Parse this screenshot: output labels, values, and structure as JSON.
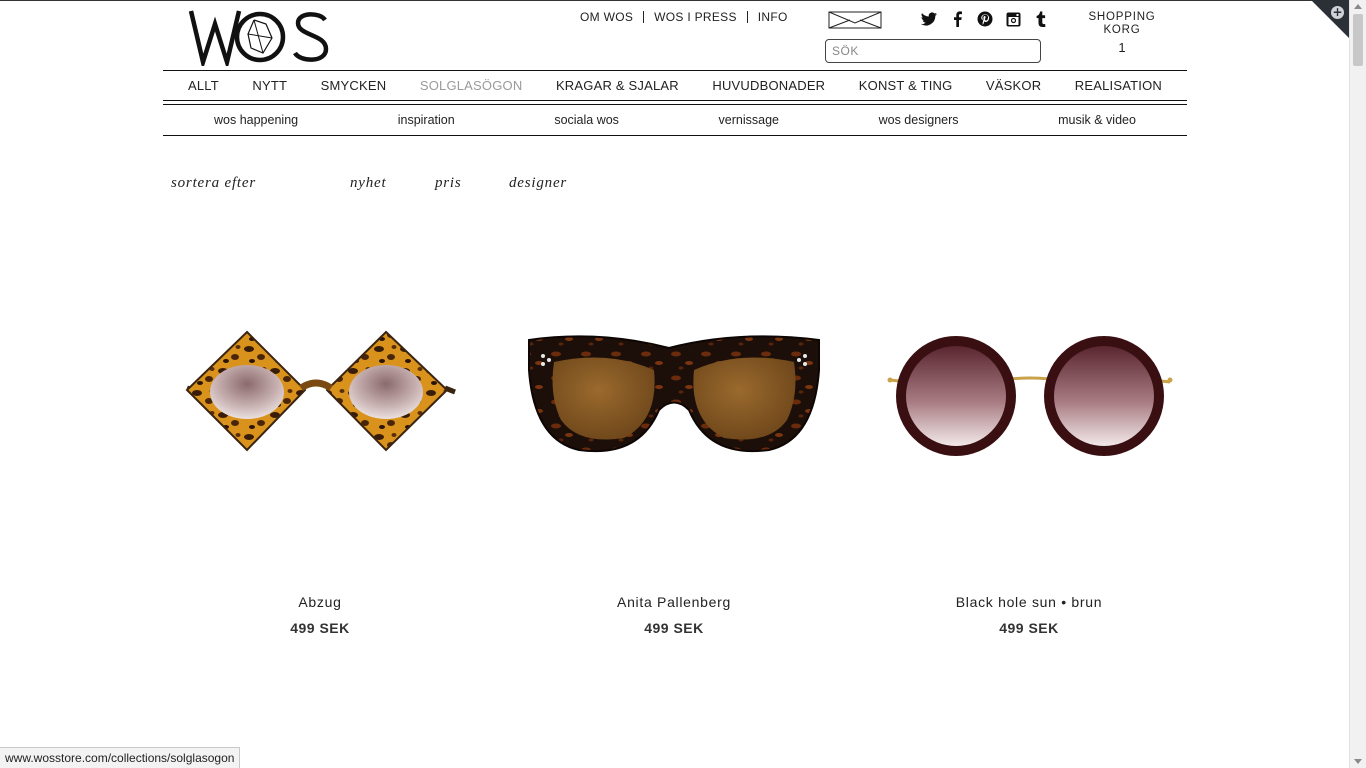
{
  "brand": {
    "logo_text": "WOS"
  },
  "top_links": [
    "OM WOS",
    "WOS I PRESS",
    "INFO"
  ],
  "search": {
    "placeholder": "SÖK",
    "value": ""
  },
  "cart": {
    "label_line1": "SHOPPING",
    "label_line2": "KORG",
    "count": "1"
  },
  "social_icons": [
    "twitter-icon",
    "facebook-icon",
    "pinterest-icon",
    "instagram-icon",
    "tumblr-icon"
  ],
  "main_nav": [
    {
      "label": "ALLT"
    },
    {
      "label": "NYTT"
    },
    {
      "label": "SMYCKEN"
    },
    {
      "label": "SOLGLASÖGON",
      "active": true
    },
    {
      "label": "KRAGAR & SJALAR"
    },
    {
      "label": "HUVUDBONADER"
    },
    {
      "label": "KONST & TING"
    },
    {
      "label": "VÄSKOR"
    },
    {
      "label": "REALISATION"
    }
  ],
  "sub_nav": [
    "wos happening",
    "inspiration",
    "sociala wos",
    "vernissage",
    "wos designers",
    "musik & video"
  ],
  "sort": {
    "label": "sortera efter",
    "options": [
      "nyhet",
      "pris",
      "designer"
    ]
  },
  "products": [
    {
      "name": "Abzug",
      "price": "499 SEK"
    },
    {
      "name": "Anita Pallenberg",
      "price": "499 SEK"
    },
    {
      "name": "Black hole sun • brun",
      "price": "499 SEK"
    }
  ],
  "status_url": "www.wosstore.com/collections/solglasogon",
  "colors": {
    "active_nav": "#9a9a9a",
    "text": "#222222",
    "ribbon": "#2b2f36"
  }
}
